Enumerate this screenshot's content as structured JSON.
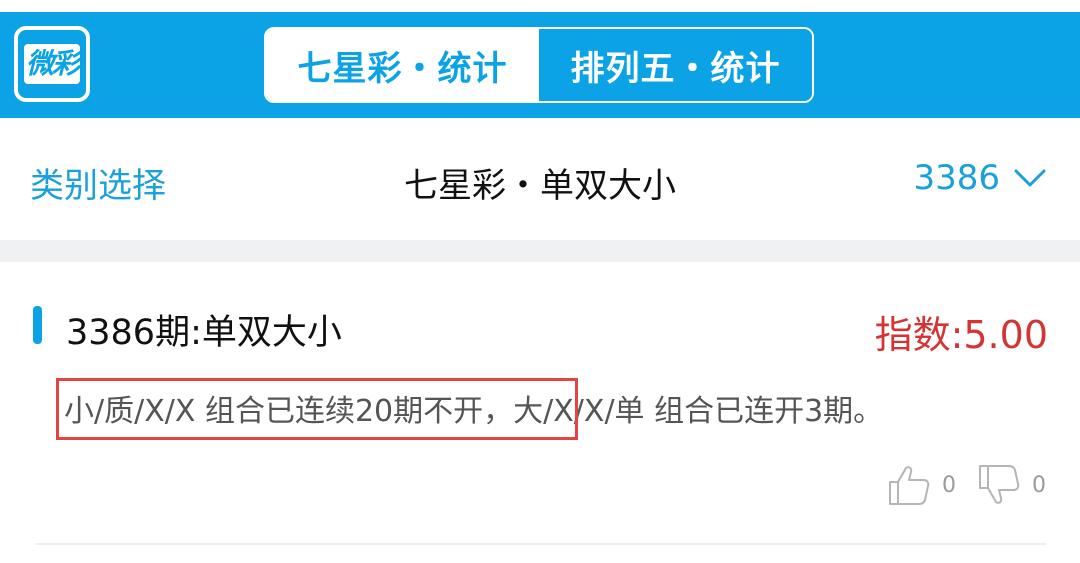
{
  "header": {
    "logo_text": "微彩",
    "tabs": [
      {
        "label": "七星彩・统计",
        "active": true
      },
      {
        "label": "排列五・统计",
        "active": false
      }
    ]
  },
  "nav": {
    "left_label": "类别选择",
    "title": "七星彩・单双大小",
    "issue_select_value": "3386"
  },
  "card": {
    "title": "3386期:单双大小",
    "index_label": "指数:5.00",
    "message": "小/质/X/X 组合已连续20期不开，大/X/X/单 组合已连开3期。",
    "like_count": "0",
    "dislike_count": "0"
  },
  "colors": {
    "brand_blue": "#0ba3e6",
    "accent_red": "#d33535",
    "highlight_border": "#e04646"
  },
  "icons": [
    "logo-icon",
    "chevron-down-icon",
    "thumbs-up-icon",
    "thumbs-down-icon"
  ]
}
